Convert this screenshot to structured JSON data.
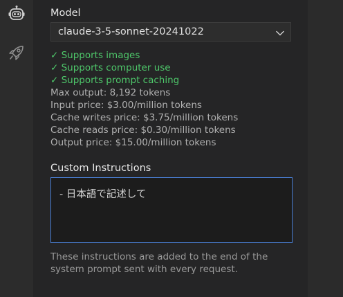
{
  "activity": {
    "items": [
      {
        "icon": "robot-icon"
      },
      {
        "icon": "rocket-icon"
      }
    ]
  },
  "model_section": {
    "label": "Model",
    "selected_model": "claude-3-5-sonnet-20241022"
  },
  "capabilities": [
    "✓ Supports images",
    "✓ Supports computer use",
    "✓ Supports prompt caching"
  ],
  "pricing": [
    {
      "key": "Max output:",
      "value": "8,192 tokens"
    },
    {
      "key": "Input price:",
      "value": "$3.00/million tokens"
    },
    {
      "key": "Cache writes price:",
      "value": "$3.75/million tokens"
    },
    {
      "key": "Cache reads price:",
      "value": "$0.30/million tokens"
    },
    {
      "key": "Output price:",
      "value": "$15.00/million tokens"
    }
  ],
  "custom_instructions": {
    "label": "Custom Instructions",
    "value": "- 日本語で記述して",
    "help": "These instructions are added to the end of the system prompt sent with every request."
  },
  "colors": {
    "success": "#4ec76a",
    "focus_border": "#4a7fd4"
  }
}
